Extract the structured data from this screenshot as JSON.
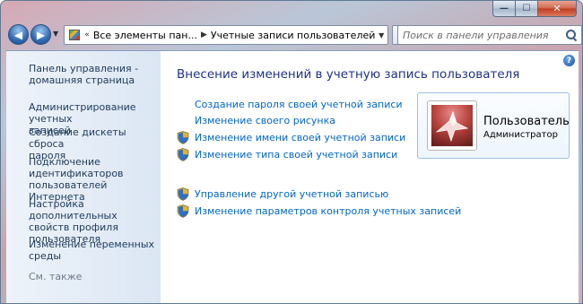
{
  "window": {
    "minimize_label": "—",
    "maximize_label": "☐",
    "close_label": "✕"
  },
  "navbar": {
    "breadcrumbs": [
      "Все элементы пан...",
      "Учетные записи пользователей"
    ],
    "search_placeholder": "Поиск в панели управления"
  },
  "sidebar": {
    "home": [
      "Панель управления -",
      "домашняя страница"
    ],
    "links": [
      [
        "Администрирование учетных",
        "записей"
      ],
      [
        "Создание дискеты сброса",
        "пароля"
      ],
      [
        "Подключение",
        "идентификаторов",
        "пользователей Интернета"
      ],
      [
        "Настройка дополнительных",
        "свойств профиля",
        "пользователя"
      ],
      [
        "Изменение переменных",
        "среды"
      ]
    ],
    "see_also": "См. также"
  },
  "main": {
    "title": "Внесение изменений в учетную запись пользователя",
    "tasks": [
      {
        "label": "Создание пароля своей учетной записи",
        "shield": false
      },
      {
        "label": "Изменение своего рисунка",
        "shield": false
      },
      {
        "label": "Изменение имени своей учетной записи",
        "shield": true
      },
      {
        "label": "Изменение типа своей учетной записи",
        "shield": true
      }
    ],
    "other_tasks": [
      {
        "label": "Управление другой учетной записью",
        "shield": true
      },
      {
        "label": "Изменение параметров контроля учетных записей",
        "shield": true
      }
    ],
    "user": {
      "name": "Пользователь",
      "role": "Администратор"
    },
    "help_label": "?"
  }
}
